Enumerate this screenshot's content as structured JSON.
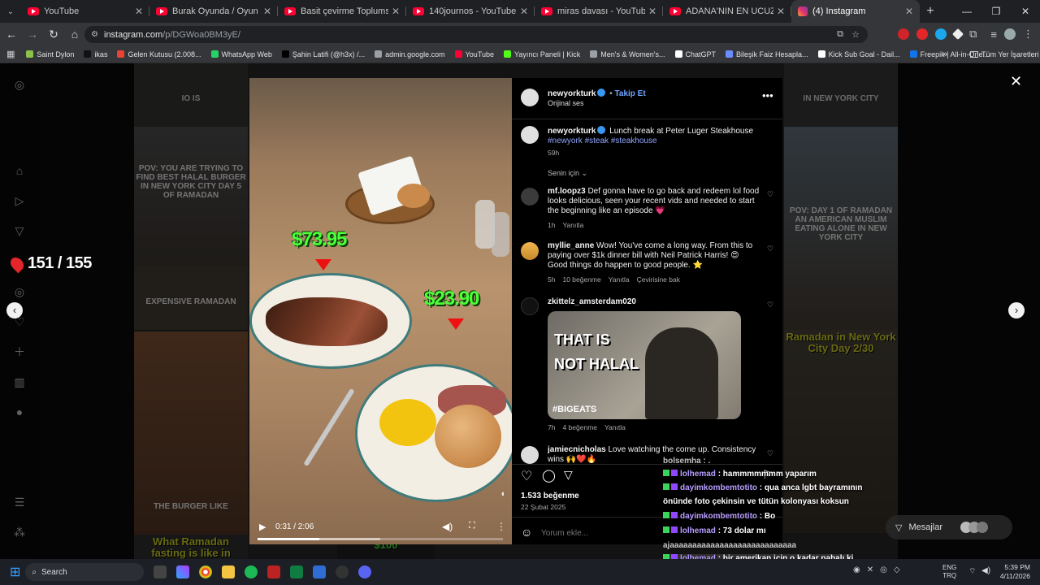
{
  "browser": {
    "tabs": [
      {
        "title": "YouTube",
        "icon": "youtube-icon",
        "active": false
      },
      {
        "title": "Burak Oyunda / Oyun Fatihi - D",
        "icon": "youtube-icon",
        "active": false
      },
      {
        "title": "Basit çevirme Toplumsal olaya",
        "icon": "youtube-icon",
        "active": false
      },
      {
        "title": "140journos - YouTube",
        "icon": "youtube-icon",
        "active": false
      },
      {
        "title": "miras davası - YouTube",
        "icon": "youtube-icon",
        "active": false
      },
      {
        "title": "ADANA'NIN EN UCUZ VE EN P",
        "icon": "youtube-icon",
        "active": false
      },
      {
        "title": "(4) Instagram",
        "icon": "instagram-icon",
        "active": true
      }
    ],
    "url_host": "instagram.com",
    "url_path": "/p/DGWoa0BM3yE/",
    "bookmarks": [
      {
        "label": "Saint Dylon",
        "color": "#8bc34a"
      },
      {
        "label": "ikas",
        "color": "#111111"
      },
      {
        "label": "Gelen Kutusu (2.008...",
        "color": "#ea4335"
      },
      {
        "label": "WhatsApp Web",
        "color": "#25d366"
      },
      {
        "label": "Şahin Latifi (@h3x) /...",
        "color": "#000000"
      },
      {
        "label": "admin.google.com",
        "color": "#9aa0a6"
      },
      {
        "label": "YouTube",
        "color": "#ff0033"
      },
      {
        "label": "Yayıncı Paneli | Kick",
        "color": "#53fc18"
      },
      {
        "label": "Men's & Women's...",
        "color": "#9aa0a6"
      },
      {
        "label": "ChatGPT",
        "color": "#ffffff"
      },
      {
        "label": "Bileşik Faiz Hesapla...",
        "color": "#6b8cff"
      },
      {
        "label": "Kick Sub Goal - Dail...",
        "color": "#ffffff"
      },
      {
        "label": "Freepik | All-in-One...",
        "color": "#1273eb"
      }
    ],
    "bookmarks_more": "»",
    "all_bookmarks": "Tüm Yer İşaretleri"
  },
  "viewer": {
    "counter": "151 / 155",
    "tiles": [
      {
        "caption": "IO IS",
        "color": "#e8e8e8"
      },
      {
        "caption": "IN NEW YORK CITY",
        "color": "#e8e8e8"
      },
      {
        "caption": "POV: YOU ARE TRYING TO FIND BEST HALAL BURGER IN NEW YORK CITY DAY 5 OF RAMADAN",
        "color": "#ffffff"
      },
      {
        "caption": "POV: DAY 1 OF RAMADAN AN AMERICAN MUSLIM EATING ALONE IN NEW YORK CITY",
        "color": "#ffffff"
      },
      {
        "caption": "EXPENSIVE RAMADAN",
        "color": "#ffffff"
      },
      {
        "caption": "Ramadan in New York City Day 2/30",
        "color": "#e6e82a"
      },
      {
        "caption": "THE BURGER LIKE",
        "color": "#ffffff"
      },
      {
        "caption": "What Ramadan fasting is like in",
        "color": "#e6e82a"
      },
      {
        "caption": "$100",
        "color": "#4cff3a"
      }
    ]
  },
  "video": {
    "price1": "$73.95",
    "price2": "$23.90",
    "time": "0:31 / 2:06",
    "progress": 0.25,
    "buffered": 0.5
  },
  "post": {
    "author": "newyorkturk",
    "follow": "Takip Et",
    "audio": "Orijinal ses",
    "caption_user": "newyorkturk",
    "caption": "Lunch break at Peter Luger Steakhouse",
    "hashtags": "#newyork #steak #steakhouse",
    "caption_age": "59h",
    "sort_label": "Senin için",
    "comments": [
      {
        "user": "mf.loopz3",
        "text": "Def gonna have to go back and redeem lol food looks delicious, seen your recent vids and needed to start the beginning like an episode 💗",
        "age": "1h",
        "likes": "",
        "reply": "Yanıtla",
        "translate": ""
      },
      {
        "user": "myllie_anne",
        "text": "Wow! You've come a long way. From this to paying over $1k dinner bill with Neil Patrick Harris! 😍 Good things do happen to good people. ⭐",
        "age": "5h",
        "likes": "10 beğenme",
        "reply": "Yanıtla",
        "translate": "Çevirisine bak"
      },
      {
        "user": "zkittelz_amsterdam020",
        "text": "",
        "gif_text": "THAT IS NOT HALAL",
        "gif_tag": "#BIGEATS",
        "age": "7h",
        "likes": "4 beğenme",
        "reply": "Yanıtla",
        "translate": ""
      },
      {
        "user": "jamiecnicholas",
        "text": "Love watching the come up. Consistency wins 🙌❤️🔥",
        "age": "",
        "likes": "",
        "reply": "",
        "translate": ""
      }
    ],
    "like_count": "1.533 beğenme",
    "date": "22 Şubat 2025",
    "comment_placeholder": "Yorum ekle..."
  },
  "stream_overlay": {
    "messages": [
      {
        "user": "",
        "text": "bolsemha : .",
        "highlight": false
      },
      {
        "user": "lolhemad",
        "text": ": hammmmmmm yaparım",
        "highlight": false
      },
      {
        "user": "dayimkombemtotito",
        "text": ": qua anca lgbt bayramının önünde foto çekinsin ve tütün kolonyası koksun",
        "highlight": false
      },
      {
        "user": "dayimkombemtotito",
        "text": ": Bo",
        "highlight": false
      },
      {
        "user": "lolhemad",
        "text": ": 73 dolar mı",
        "highlight": false
      },
      {
        "user": "",
        "text": "ajaaaaaaaaaaaaaaaaaaaaaaaaaaaa",
        "highlight": false
      },
      {
        "user": "lolhemad",
        "text": ": bir amerikan için o kadar pahalı ki",
        "highlight": true
      }
    ],
    "messages_label": "Mesajlar"
  },
  "taskbar": {
    "search": "Search",
    "lang_top": "ENG",
    "lang_bottom": "TRQ",
    "time": "5:39 PM",
    "date": "4/11/2026"
  }
}
